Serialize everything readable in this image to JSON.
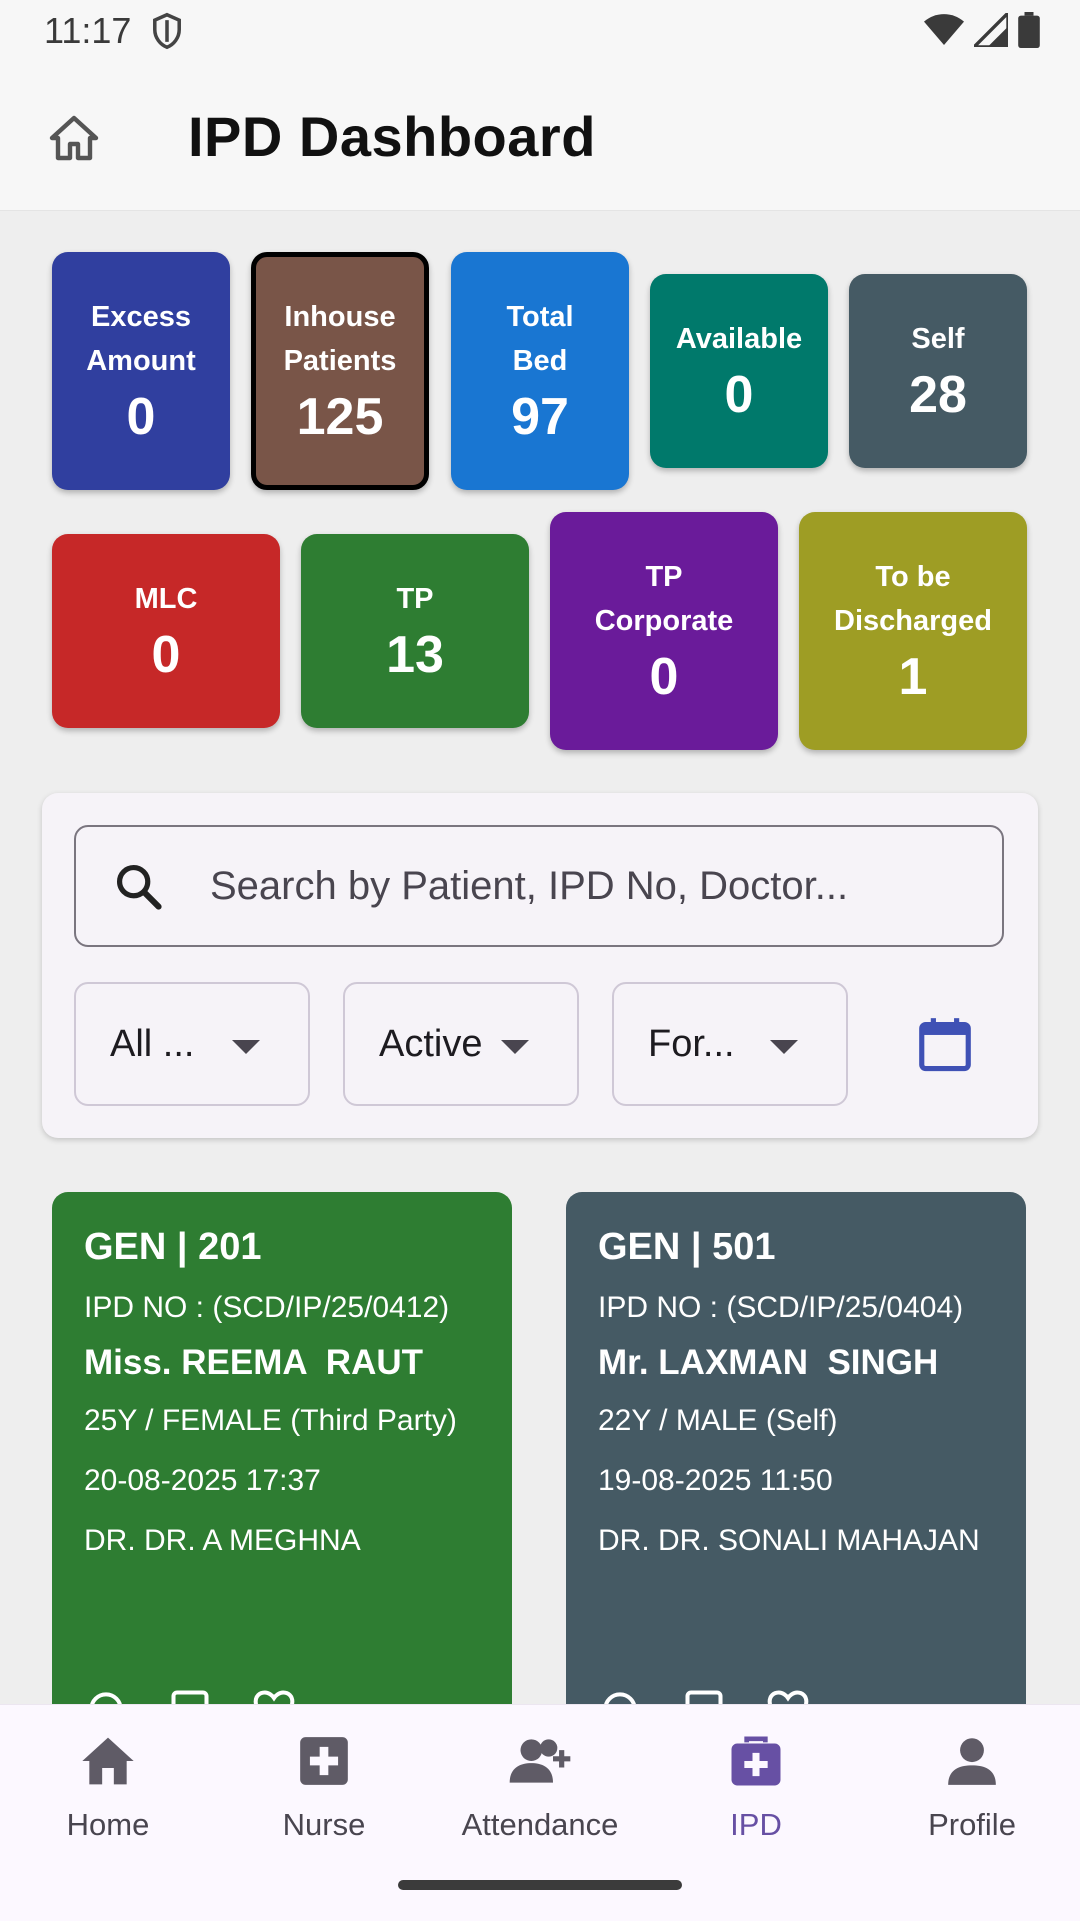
{
  "status_bar": {
    "time": "11:17"
  },
  "app_bar": {
    "title": "IPD Dashboard"
  },
  "stats": [
    {
      "label": "Excess\nAmount",
      "value": "0",
      "color": "#303f9f"
    },
    {
      "label": "Inhouse\nPatients",
      "value": "125",
      "color": "#795548",
      "selected": true
    },
    {
      "label": "Total\nBed",
      "value": "97",
      "color": "#1976d2"
    },
    {
      "label": "Available",
      "value": "0",
      "color": "#00796b"
    },
    {
      "label": "Self",
      "value": "28",
      "color": "#455a64"
    },
    {
      "label": "MLC",
      "value": "0",
      "color": "#c62828"
    },
    {
      "label": "TP",
      "value": "13",
      "color": "#2e7d32"
    },
    {
      "label": "TP\nCorporate",
      "value": "0",
      "color": "#6a1b9a"
    },
    {
      "label": "To be\nDischarged",
      "value": "1",
      "color": "#9e9d24"
    }
  ],
  "search": {
    "placeholder": "Search by Patient, IPD No, Doctor..."
  },
  "filters": {
    "ward": "All ...",
    "status": "Active",
    "type": "For..."
  },
  "patients": [
    {
      "bed": "GEN | 201",
      "ipd": "IPD NO : (SCD/IP/25/0412)",
      "name": "Miss. REEMA  RAUT",
      "info": "25Y / FEMALE (Third Party)",
      "date": "20-08-2025 17:37",
      "doctor": "DR. DR. A MEGHNA",
      "color": "#2e7d32"
    },
    {
      "bed": "GEN | 501",
      "ipd": "IPD NO : (SCD/IP/25/0404)",
      "name": "Mr. LAXMAN  SINGH",
      "info": "22Y / MALE (Self)",
      "date": "19-08-2025 11:50",
      "doctor": "DR. DR. SONALI MAHAJAN",
      "color": "#455a64"
    }
  ],
  "nav": [
    {
      "label": "Home",
      "icon": "home-icon"
    },
    {
      "label": "Nurse",
      "icon": "medical-plus-icon"
    },
    {
      "label": "Attendance",
      "icon": "person-add-icon"
    },
    {
      "label": "IPD",
      "icon": "medical-bag-icon",
      "active": true
    },
    {
      "label": "Profile",
      "icon": "person-icon"
    }
  ],
  "colors": {
    "accent": "#6750a4",
    "calendar": "#3f51b5"
  }
}
